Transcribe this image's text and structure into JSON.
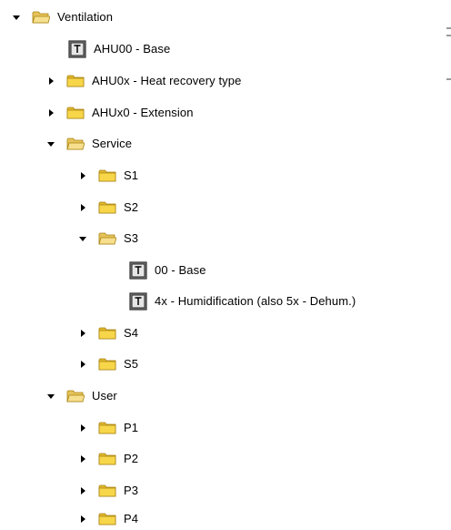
{
  "tree": {
    "root": {
      "label": "Ventilation",
      "icon": "folder-open-icon",
      "expanded": true
    },
    "items": {
      "ahu00": {
        "label": "AHU00 - Base",
        "icon": "template-icon"
      },
      "ahu0x": {
        "label": "AHU0x - Heat recovery type",
        "icon": "folder-icon",
        "expanded": false
      },
      "ahux0": {
        "label": "AHUx0 - Extension",
        "icon": "folder-icon",
        "expanded": false
      },
      "service": {
        "label": "Service",
        "icon": "folder-open-icon",
        "expanded": true,
        "children": {
          "s1": {
            "label": "S1",
            "icon": "folder-icon",
            "expanded": false
          },
          "s2": {
            "label": "S2",
            "icon": "folder-icon",
            "expanded": false
          },
          "s3": {
            "label": "S3",
            "icon": "folder-open-icon",
            "expanded": true,
            "children": {
              "base": {
                "label": "00 - Base",
                "icon": "template-icon"
              },
              "humid": {
                "label": "4x - Humidification (also 5x - Dehum.)",
                "icon": "template-icon"
              }
            }
          },
          "s4": {
            "label": "S4",
            "icon": "folder-icon",
            "expanded": false
          },
          "s5": {
            "label": "S5",
            "icon": "folder-icon",
            "expanded": false
          }
        }
      },
      "user": {
        "label": "User",
        "icon": "folder-open-icon",
        "expanded": true,
        "children": {
          "p1": {
            "label": "P1",
            "icon": "folder-icon",
            "expanded": false
          },
          "p2": {
            "label": "P2",
            "icon": "folder-icon",
            "expanded": false
          },
          "p3": {
            "label": "P3",
            "icon": "folder-icon",
            "expanded": false
          },
          "p4": {
            "label": "P4",
            "icon": "folder-icon",
            "expanded": false
          }
        }
      }
    }
  },
  "colors": {
    "folder_fill": "#f7d64a",
    "folder_border": "#c9a31c",
    "folder_open_fill": "#f4dd8a",
    "template_fill": "#c8c8c8",
    "arrow": "#000000"
  }
}
